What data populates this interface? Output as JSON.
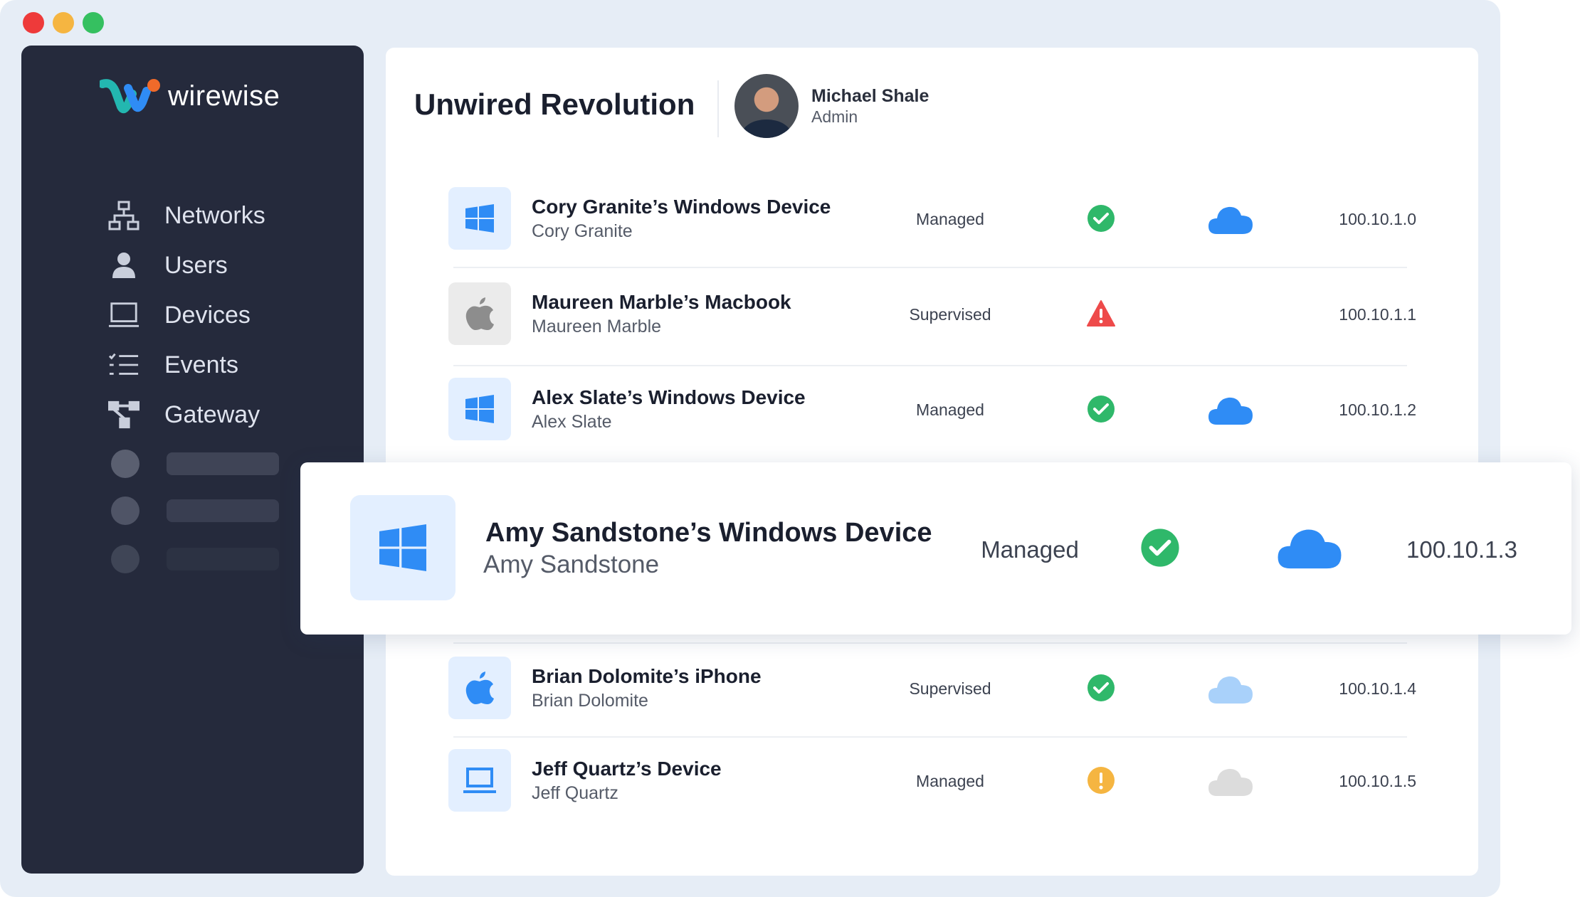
{
  "app": {
    "brand_name": "wirewise",
    "workspace_title": "Unwired Revolution"
  },
  "user": {
    "name": "Michael Shale",
    "role": "Admin"
  },
  "sidebar": {
    "items": [
      {
        "label": "Networks",
        "icon": "network-icon"
      },
      {
        "label": "Users",
        "icon": "user-icon"
      },
      {
        "label": "Devices",
        "icon": "laptop-icon"
      },
      {
        "label": "Events",
        "icon": "list-icon"
      },
      {
        "label": "Gateway",
        "icon": "gateway-icon"
      }
    ]
  },
  "devices": [
    {
      "name": "Cory Granite’s Windows Device",
      "owner": "Cory Granite",
      "management": "Managed",
      "status": "ok",
      "cloud": "connected",
      "ip": "100.10.1.0",
      "icon": "windows-icon"
    },
    {
      "name": "Maureen Marble’s Macbook",
      "owner": "Maureen Marble",
      "management": "Supervised",
      "status": "error",
      "cloud": "none",
      "ip": "100.10.1.1",
      "icon": "apple-icon"
    },
    {
      "name": "Alex Slate’s Windows Device",
      "owner": "Alex Slate",
      "management": "Managed",
      "status": "ok",
      "cloud": "connected",
      "ip": "100.10.1.2",
      "icon": "windows-icon"
    },
    {
      "name": "Amy Sandstone’s Windows Device",
      "owner": "Amy Sandstone",
      "management": "Managed",
      "status": "ok",
      "cloud": "connected",
      "ip": "100.10.1.3",
      "icon": "windows-icon"
    },
    {
      "name": "Brian Dolomite’s iPhone",
      "owner": "Brian Dolomite",
      "management": "Supervised",
      "status": "ok",
      "cloud": "partial",
      "ip": "100.10.1.4",
      "icon": "apple-icon"
    },
    {
      "name": "Jeff Quartz’s Device",
      "owner": "Jeff Quartz",
      "management": "Managed",
      "status": "warning",
      "cloud": "offline",
      "ip": "100.10.1.5",
      "icon": "laptop-icon"
    }
  ],
  "colors": {
    "sidebar_bg": "#252a3c",
    "accent_blue": "#2f8cf5",
    "status_ok": "#2fb86a",
    "status_error": "#ee4a4a",
    "status_warning": "#f5b541",
    "cloud_partial": "#a9d1fa",
    "cloud_offline": "#dcdcdc"
  }
}
